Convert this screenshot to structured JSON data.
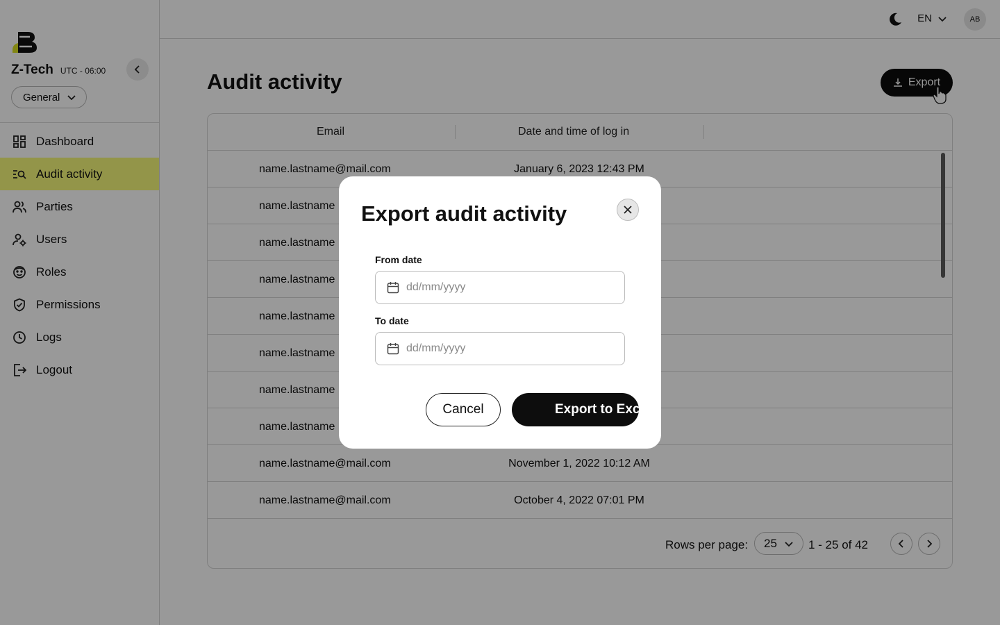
{
  "sidebar": {
    "org_name": "Z-Tech",
    "org_timezone": "UTC - 06:00",
    "scope_selected": "General",
    "items": [
      {
        "label": "Dashboard",
        "icon": "dashboard-icon"
      },
      {
        "label": "Audit activity",
        "icon": "audit-search-icon",
        "active": true
      },
      {
        "label": "Parties",
        "icon": "people-icon"
      },
      {
        "label": "Users",
        "icon": "user-gear-icon"
      },
      {
        "label": "Roles",
        "icon": "face-icon"
      },
      {
        "label": "Permissions",
        "icon": "shield-check-icon"
      },
      {
        "label": "Logs",
        "icon": "clock-icon"
      },
      {
        "label": "Logout",
        "icon": "logout-icon"
      }
    ]
  },
  "header": {
    "language": "EN",
    "avatar_initials": "AB"
  },
  "main": {
    "title": "Audit activity",
    "export_label": "Export",
    "columns": [
      "Email",
      "Date and time of log in"
    ],
    "rows": [
      {
        "email": "name.lastname@mail.com",
        "date": "January 6, 2023 12:43 PM"
      },
      {
        "email": "name.lastname",
        "date": ""
      },
      {
        "email": "name.lastname",
        "date": ""
      },
      {
        "email": "name.lastname",
        "date": ""
      },
      {
        "email": "name.lastname",
        "date": ""
      },
      {
        "email": "name.lastname",
        "date": ""
      },
      {
        "email": "name.lastname",
        "date": ""
      },
      {
        "email": "name.lastname",
        "date": ""
      },
      {
        "email": "name.lastname@mail.com",
        "date": "November 1, 2022 10:12 AM"
      },
      {
        "email": "name.lastname@mail.com",
        "date": "October 4, 2022 07:01 PM"
      }
    ],
    "pagination": {
      "rows_per_page_label": "Rows per page:",
      "rows_per_page_value": "25",
      "range": "1 - 25 of 42"
    }
  },
  "modal": {
    "title": "Export audit activity",
    "from_label": "From date",
    "from_placeholder": "dd/mm/yyyy",
    "to_label": "To date",
    "to_placeholder": "dd/mm/yyyy",
    "cancel_label": "Cancel",
    "confirm_label": "Export to Excel"
  },
  "colors": {
    "active_nav": "#f6f97a",
    "primary_button": "#0d0d0d",
    "overlay": "rgba(0,0,0,0.4)"
  }
}
